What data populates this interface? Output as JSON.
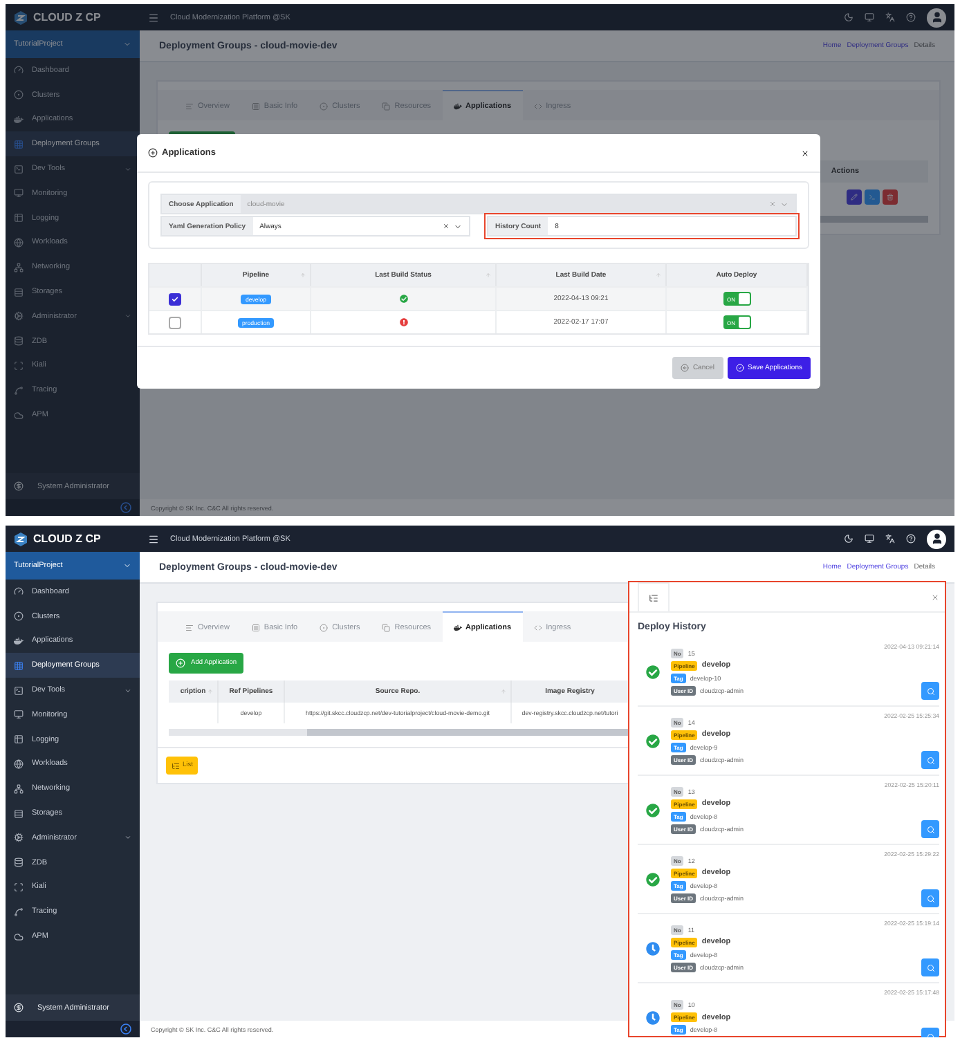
{
  "screens": [
    {
      "kind": "modal",
      "brand": "CLOUD Z CP",
      "platform": "Cloud Modernization Platform @SK",
      "project": "TutorialProject",
      "nav": [
        {
          "label": "Dashboard",
          "kind": "link",
          "selected": false
        },
        {
          "label": "Clusters",
          "kind": "link",
          "selected": false
        },
        {
          "label": "Applications",
          "kind": "link",
          "selected": false
        },
        {
          "label": "Deployment Groups",
          "kind": "link",
          "selected": true
        },
        {
          "label": "Dev Tools",
          "kind": "group",
          "selected": false
        },
        {
          "label": "Monitoring",
          "kind": "link",
          "selected": false
        },
        {
          "label": "Logging",
          "kind": "link",
          "selected": false
        },
        {
          "label": "Workloads",
          "kind": "link",
          "selected": false
        },
        {
          "label": "Networking",
          "kind": "link",
          "selected": false
        },
        {
          "label": "Storages",
          "kind": "link",
          "selected": false
        },
        {
          "label": "Administrator",
          "kind": "group",
          "selected": false
        },
        {
          "label": "ZDB",
          "kind": "link",
          "selected": false
        },
        {
          "label": "Kiali",
          "kind": "link",
          "selected": false
        },
        {
          "label": "Tracing",
          "kind": "link",
          "selected": false
        },
        {
          "label": "APM",
          "kind": "link",
          "selected": false
        }
      ],
      "user": "System Administrator",
      "page_title": "Deployment Groups - cloud-movie-dev",
      "breadcrumbs": [
        "Home",
        "Deployment Groups",
        "Details"
      ],
      "tabs": [
        {
          "label": "Overview",
          "selected": false
        },
        {
          "label": "Basic Info",
          "selected": false
        },
        {
          "label": "Clusters",
          "selected": false
        },
        {
          "label": "Resources",
          "selected": false
        },
        {
          "label": "Applications",
          "selected": true
        },
        {
          "label": "Ingress",
          "selected": false
        }
      ],
      "actions_header": "Actions",
      "copyright": "Copyright © SK Inc. C&C All rights reserved.",
      "modal": {
        "title": "Applications",
        "fields": [
          {
            "kind": "select",
            "label": "Choose Application",
            "value": "cloud-movie",
            "disabled": true,
            "highlighted": false
          },
          {
            "kind": "select",
            "label": "Yaml Generation Policy",
            "value": "Always",
            "disabled": false,
            "highlighted": false
          },
          {
            "kind": "input",
            "label": "History Count",
            "value": "8",
            "disabled": false,
            "highlighted": true
          }
        ],
        "columns": [
          {
            "label": "Pipeline",
            "sortable": true
          },
          {
            "label": "Last Build Status",
            "sortable": true
          },
          {
            "label": "Last Build Date",
            "sortable": true
          },
          {
            "label": "Auto Deploy",
            "sortable": false
          }
        ],
        "rows": [
          {
            "selected": true,
            "pipeline": "develop",
            "succeeded": true,
            "date": "2022-04-13 09:21",
            "auto_deploy": true,
            "auto_deploy_label": "ON"
          },
          {
            "selected": false,
            "pipeline": "production",
            "succeeded": false,
            "date": "2022-02-17 17:07",
            "auto_deploy": true,
            "auto_deploy_label": "ON"
          }
        ],
        "cancel": "Cancel",
        "save": "Save Applications"
      }
    },
    {
      "kind": "history",
      "brand": "CLOUD Z CP",
      "platform": "Cloud Modernization Platform @SK",
      "project": "TutorialProject",
      "nav": [
        {
          "label": "Dashboard",
          "kind": "link",
          "selected": false
        },
        {
          "label": "Clusters",
          "kind": "link",
          "selected": false
        },
        {
          "label": "Applications",
          "kind": "link",
          "selected": false
        },
        {
          "label": "Deployment Groups",
          "kind": "link",
          "selected": true
        },
        {
          "label": "Dev Tools",
          "kind": "group",
          "selected": false
        },
        {
          "label": "Monitoring",
          "kind": "link",
          "selected": false
        },
        {
          "label": "Logging",
          "kind": "link",
          "selected": false
        },
        {
          "label": "Workloads",
          "kind": "link",
          "selected": false
        },
        {
          "label": "Networking",
          "kind": "link",
          "selected": false
        },
        {
          "label": "Storages",
          "kind": "link",
          "selected": false
        },
        {
          "label": "Administrator",
          "kind": "group",
          "selected": false
        },
        {
          "label": "ZDB",
          "kind": "link",
          "selected": false
        },
        {
          "label": "Kiali",
          "kind": "link",
          "selected": false
        },
        {
          "label": "Tracing",
          "kind": "link",
          "selected": false
        },
        {
          "label": "APM",
          "kind": "link",
          "selected": false
        }
      ],
      "user": "System Administrator",
      "page_title": "Deployment Groups - cloud-movie-dev",
      "breadcrumbs": [
        "Home",
        "Deployment Groups",
        "Details"
      ],
      "tabs": [
        {
          "label": "Overview",
          "selected": false
        },
        {
          "label": "Basic Info",
          "selected": false
        },
        {
          "label": "Clusters",
          "selected": false
        },
        {
          "label": "Resources",
          "selected": false
        },
        {
          "label": "Applications",
          "selected": true
        },
        {
          "label": "Ingress",
          "selected": false
        }
      ],
      "add_button": "Add Application",
      "table": {
        "columns": [
          {
            "label": "cription",
            "sortable": true
          },
          {
            "label": "Ref Pipelines",
            "sortable": false
          },
          {
            "label": "Source Repo.",
            "sortable": true
          },
          {
            "label": "Image Registry",
            "sortable": false
          }
        ],
        "rows": [
          {
            "ref_pipelines": "develop",
            "source_repo": "https://git.skcc.cloudzcp.net/dev-tutorialproject/cloud-movie-demo.git",
            "image_registry": "dev-registry.skcc.cloudzcp.net/tutori"
          }
        ]
      },
      "list_button": "List",
      "copyright": "Copyright © SK Inc. C&C All rights reserved.",
      "history": {
        "title": "Deploy History",
        "highlighted": true,
        "entries": [
          {
            "completed": true,
            "date": "2022-04-13 09:21:14",
            "fields": [
              {
                "kind": "no",
                "label": "No",
                "value": "15"
              },
              {
                "kind": "pipeline",
                "label": "Pipeline",
                "value": "develop"
              },
              {
                "kind": "tag",
                "label": "Tag",
                "value": "develop-10"
              },
              {
                "kind": "user",
                "label": "User ID",
                "value": "cloudzcp-admin"
              }
            ]
          },
          {
            "completed": true,
            "date": "2022-02-25 15:25:34",
            "fields": [
              {
                "kind": "no",
                "label": "No",
                "value": "14"
              },
              {
                "kind": "pipeline",
                "label": "Pipeline",
                "value": "develop"
              },
              {
                "kind": "tag",
                "label": "Tag",
                "value": "develop-9"
              },
              {
                "kind": "user",
                "label": "User ID",
                "value": "cloudzcp-admin"
              }
            ]
          },
          {
            "completed": true,
            "date": "2022-02-25 15:20:11",
            "fields": [
              {
                "kind": "no",
                "label": "No",
                "value": "13"
              },
              {
                "kind": "pipeline",
                "label": "Pipeline",
                "value": "develop"
              },
              {
                "kind": "tag",
                "label": "Tag",
                "value": "develop-8"
              },
              {
                "kind": "user",
                "label": "User ID",
                "value": "cloudzcp-admin"
              }
            ]
          },
          {
            "completed": true,
            "date": "2022-02-25 15:29:22",
            "fields": [
              {
                "kind": "no",
                "label": "No",
                "value": "12"
              },
              {
                "kind": "pipeline",
                "label": "Pipeline",
                "value": "develop"
              },
              {
                "kind": "tag",
                "label": "Tag",
                "value": "develop-8"
              },
              {
                "kind": "user",
                "label": "User ID",
                "value": "cloudzcp-admin"
              }
            ]
          },
          {
            "completed": false,
            "date": "2022-02-25 15:19:14",
            "fields": [
              {
                "kind": "no",
                "label": "No",
                "value": "11"
              },
              {
                "kind": "pipeline",
                "label": "Pipeline",
                "value": "develop"
              },
              {
                "kind": "tag",
                "label": "Tag",
                "value": "develop-8"
              },
              {
                "kind": "user",
                "label": "User ID",
                "value": "cloudzcp-admin"
              }
            ]
          },
          {
            "completed": false,
            "date": "2022-02-25 15:17:48",
            "fields": [
              {
                "kind": "no",
                "label": "No",
                "value": "10"
              },
              {
                "kind": "pipeline",
                "label": "Pipeline",
                "value": "develop"
              },
              {
                "kind": "tag",
                "label": "Tag",
                "value": "develop-8"
              }
            ]
          }
        ]
      }
    }
  ]
}
